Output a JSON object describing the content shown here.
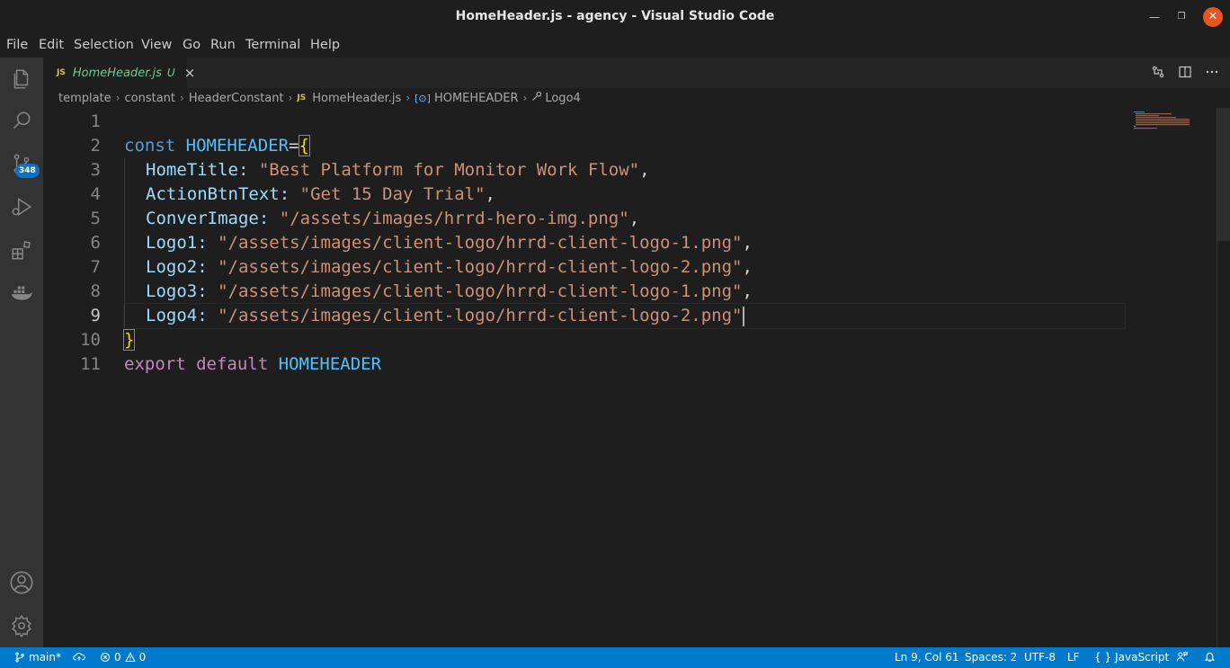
{
  "window": {
    "title": "HomeHeader.js - agency - Visual Studio Code",
    "minimize": "—",
    "maximize": "❐",
    "close": "✕"
  },
  "menu": [
    {
      "label": "File"
    },
    {
      "label": "Edit"
    },
    {
      "label": "Selection"
    },
    {
      "label": "View"
    },
    {
      "label": "Go"
    },
    {
      "label": "Run"
    },
    {
      "label": "Terminal"
    },
    {
      "label": "Help"
    }
  ],
  "activity_bar": {
    "items": [
      "explorer-icon",
      "search-icon",
      "source-control-icon",
      "run-debug-icon",
      "extensions-icon",
      "docker-icon"
    ],
    "source_control_badge": "348",
    "bottom": [
      "account-icon",
      "settings-gear-icon"
    ]
  },
  "tab": {
    "lang": "JS",
    "filename": "HomeHeader.js",
    "status": "U",
    "close": "×"
  },
  "breadcrumb": {
    "parts": [
      "template",
      "constant",
      "HeaderConstant"
    ],
    "file_lang": "JS",
    "file": "HomeHeader.js",
    "symbol": "HOMEHEADER",
    "property": "Logo4",
    "sep": "›"
  },
  "editor": {
    "line_numbers": [
      "1",
      "2",
      "3",
      "4",
      "5",
      "6",
      "7",
      "8",
      "9",
      "10",
      "11"
    ],
    "current_line": 9,
    "code": {
      "l2_kw": "const",
      "l2_name": "HOMEHEADER",
      "l2_op": "=",
      "l2_brace": "{",
      "l3_prop": "HomeTitle",
      "l3_val": "\"Best Platform for Monitor Work Flow\"",
      "l4_prop": "ActionBtnText",
      "l4_val": "\"Get 15 Day Trial\"",
      "l5_prop": "ConverImage",
      "l5_val": "\"/assets/images/hrrd-hero-img.png\"",
      "l6_prop": "Logo1",
      "l6_val": "\"/assets/images/client-logo/hrrd-client-logo-1.png\"",
      "l7_prop": "Logo2",
      "l7_val": "\"/assets/images/client-logo/hrrd-client-logo-2.png\"",
      "l8_prop": "Logo3",
      "l8_val": "\"/assets/images/client-logo/hrrd-client-logo-1.png\"",
      "l9_prop": "Logo4",
      "l9_val": "\"/assets/images/client-logo/hrrd-client-logo-2.png\"",
      "l10_brace": "}",
      "l11_kw1": "export",
      "l11_kw2": "default",
      "l11_name": "HOMEHEADER",
      "colon": ":",
      "comma": ","
    }
  },
  "status_bar": {
    "branch": "main*",
    "errors": "0",
    "warnings": "0",
    "position": "Ln 9, Col 61",
    "spaces": "Spaces: 2",
    "encoding": "UTF-8",
    "eol": "LF",
    "language_icon": "{ }",
    "language": "JavaScript"
  },
  "colors": {
    "status_bar": "#007acc",
    "activity_bar": "#333333",
    "editor_bg": "#1e1e1e",
    "keyword": "#569cd6",
    "string": "#ce9178",
    "property": "#9cdcfe",
    "constant": "#4fc1ff"
  }
}
